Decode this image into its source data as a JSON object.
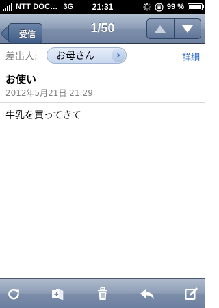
{
  "status_bar": {
    "carrier": "NTT DOC…",
    "network": "3G",
    "time": "21:31",
    "battery_pct": "99 %",
    "battery_level": 0.99,
    "icons": [
      "signal-icon",
      "activity-spinner-icon",
      "orientation-lock-icon",
      "battery-icon"
    ]
  },
  "nav": {
    "back_label": "受信",
    "title": "1/50",
    "prev_icon": "triangle-up-icon",
    "next_icon": "triangle-down-icon",
    "colors": {
      "bar": "#7e90aa",
      "button": "#3f5b86"
    }
  },
  "header": {
    "from_label": "差出人:",
    "from_name": "お母さん",
    "details_label": "詳細",
    "subject": "お使い",
    "date": "2012年5月21日 21:29"
  },
  "message": {
    "body": "牛乳を買ってきて"
  },
  "toolbar": {
    "icons": [
      "refresh-icon",
      "move-to-folder-icon",
      "trash-icon",
      "reply-icon",
      "compose-icon"
    ]
  },
  "colors": {
    "link": "#2a65c7",
    "label_gray": "#7f7f7f"
  }
}
